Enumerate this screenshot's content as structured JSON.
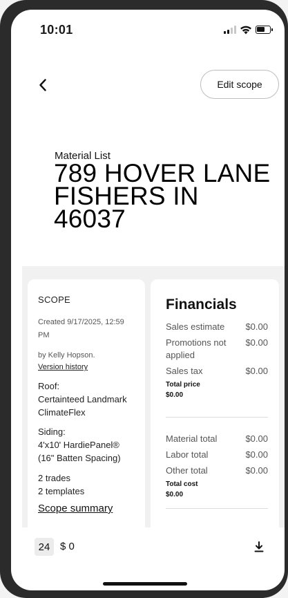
{
  "status_bar": {
    "time": "10:01"
  },
  "nav": {
    "edit_scope_label": "Edit scope"
  },
  "header": {
    "label": "Material List",
    "address": "789 HOVER LANE FISHERS IN 46037"
  },
  "scope": {
    "title": "SCOPE",
    "created": "Created 9/17/2025, 12:59 PM",
    "by": "by Kelly Hopson.",
    "version_history_label": "Version history",
    "roof": "Roof:\nCertainteed Landmark ClimateFlex",
    "siding": "Siding:\n4'x10' HardiePanel® (16\" Batten Spacing)",
    "trades": "2 trades",
    "templates": "2 templates",
    "summary_label": "Scope summary"
  },
  "financials": {
    "title": "Financials",
    "rows_a": [
      {
        "label": "Sales estimate",
        "value": "$0.00"
      },
      {
        "label": "Promotions not applied",
        "value": "$0.00"
      },
      {
        "label": "Sales tax",
        "value": "$0.00"
      }
    ],
    "total_price_label": "Total price",
    "total_price_value": "$0.00",
    "rows_b": [
      {
        "label": "Material total",
        "value": "$0.00"
      },
      {
        "label": "Labor total",
        "value": "$0.00"
      },
      {
        "label": "Other total",
        "value": "$0.00"
      }
    ],
    "total_cost_label": "Total cost",
    "total_cost_value": "$0.00"
  },
  "bottom_bar": {
    "count": "24",
    "total": "$ 0"
  },
  "icons": {
    "back": "chevron-left-icon",
    "download": "download-icon",
    "signal": "signal-icon",
    "wifi": "wifi-icon",
    "battery": "battery-icon"
  }
}
